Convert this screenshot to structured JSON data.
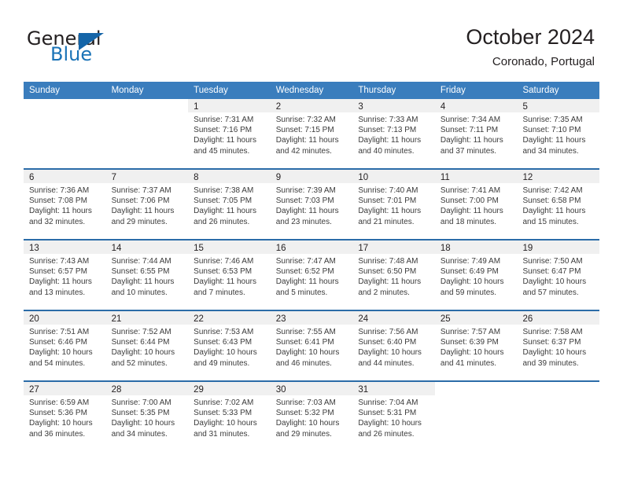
{
  "brand": {
    "name_part1": "General",
    "name_part2": "Blue",
    "accent_color": "#1a73b7",
    "triangle_color": "#1565a8"
  },
  "header": {
    "title": "October 2024",
    "subtitle": "Coronado, Portugal"
  },
  "theme": {
    "header_row_bg": "#3a7dbd",
    "week_divider": "#2b6ca8",
    "daynum_band_bg": "#f0f0f0",
    "text": "#231f20"
  },
  "weekdays": [
    "Sunday",
    "Monday",
    "Tuesday",
    "Wednesday",
    "Thursday",
    "Friday",
    "Saturday"
  ],
  "weeks": [
    [
      {
        "day": "",
        "lines": []
      },
      {
        "day": "",
        "lines": []
      },
      {
        "day": "1",
        "lines": [
          "Sunrise: 7:31 AM",
          "Sunset: 7:16 PM",
          "Daylight: 11 hours",
          "and 45 minutes."
        ]
      },
      {
        "day": "2",
        "lines": [
          "Sunrise: 7:32 AM",
          "Sunset: 7:15 PM",
          "Daylight: 11 hours",
          "and 42 minutes."
        ]
      },
      {
        "day": "3",
        "lines": [
          "Sunrise: 7:33 AM",
          "Sunset: 7:13 PM",
          "Daylight: 11 hours",
          "and 40 minutes."
        ]
      },
      {
        "day": "4",
        "lines": [
          "Sunrise: 7:34 AM",
          "Sunset: 7:11 PM",
          "Daylight: 11 hours",
          "and 37 minutes."
        ]
      },
      {
        "day": "5",
        "lines": [
          "Sunrise: 7:35 AM",
          "Sunset: 7:10 PM",
          "Daylight: 11 hours",
          "and 34 minutes."
        ]
      }
    ],
    [
      {
        "day": "6",
        "lines": [
          "Sunrise: 7:36 AM",
          "Sunset: 7:08 PM",
          "Daylight: 11 hours",
          "and 32 minutes."
        ]
      },
      {
        "day": "7",
        "lines": [
          "Sunrise: 7:37 AM",
          "Sunset: 7:06 PM",
          "Daylight: 11 hours",
          "and 29 minutes."
        ]
      },
      {
        "day": "8",
        "lines": [
          "Sunrise: 7:38 AM",
          "Sunset: 7:05 PM",
          "Daylight: 11 hours",
          "and 26 minutes."
        ]
      },
      {
        "day": "9",
        "lines": [
          "Sunrise: 7:39 AM",
          "Sunset: 7:03 PM",
          "Daylight: 11 hours",
          "and 23 minutes."
        ]
      },
      {
        "day": "10",
        "lines": [
          "Sunrise: 7:40 AM",
          "Sunset: 7:01 PM",
          "Daylight: 11 hours",
          "and 21 minutes."
        ]
      },
      {
        "day": "11",
        "lines": [
          "Sunrise: 7:41 AM",
          "Sunset: 7:00 PM",
          "Daylight: 11 hours",
          "and 18 minutes."
        ]
      },
      {
        "day": "12",
        "lines": [
          "Sunrise: 7:42 AM",
          "Sunset: 6:58 PM",
          "Daylight: 11 hours",
          "and 15 minutes."
        ]
      }
    ],
    [
      {
        "day": "13",
        "lines": [
          "Sunrise: 7:43 AM",
          "Sunset: 6:57 PM",
          "Daylight: 11 hours",
          "and 13 minutes."
        ]
      },
      {
        "day": "14",
        "lines": [
          "Sunrise: 7:44 AM",
          "Sunset: 6:55 PM",
          "Daylight: 11 hours",
          "and 10 minutes."
        ]
      },
      {
        "day": "15",
        "lines": [
          "Sunrise: 7:46 AM",
          "Sunset: 6:53 PM",
          "Daylight: 11 hours",
          "and 7 minutes."
        ]
      },
      {
        "day": "16",
        "lines": [
          "Sunrise: 7:47 AM",
          "Sunset: 6:52 PM",
          "Daylight: 11 hours",
          "and 5 minutes."
        ]
      },
      {
        "day": "17",
        "lines": [
          "Sunrise: 7:48 AM",
          "Sunset: 6:50 PM",
          "Daylight: 11 hours",
          "and 2 minutes."
        ]
      },
      {
        "day": "18",
        "lines": [
          "Sunrise: 7:49 AM",
          "Sunset: 6:49 PM",
          "Daylight: 10 hours",
          "and 59 minutes."
        ]
      },
      {
        "day": "19",
        "lines": [
          "Sunrise: 7:50 AM",
          "Sunset: 6:47 PM",
          "Daylight: 10 hours",
          "and 57 minutes."
        ]
      }
    ],
    [
      {
        "day": "20",
        "lines": [
          "Sunrise: 7:51 AM",
          "Sunset: 6:46 PM",
          "Daylight: 10 hours",
          "and 54 minutes."
        ]
      },
      {
        "day": "21",
        "lines": [
          "Sunrise: 7:52 AM",
          "Sunset: 6:44 PM",
          "Daylight: 10 hours",
          "and 52 minutes."
        ]
      },
      {
        "day": "22",
        "lines": [
          "Sunrise: 7:53 AM",
          "Sunset: 6:43 PM",
          "Daylight: 10 hours",
          "and 49 minutes."
        ]
      },
      {
        "day": "23",
        "lines": [
          "Sunrise: 7:55 AM",
          "Sunset: 6:41 PM",
          "Daylight: 10 hours",
          "and 46 minutes."
        ]
      },
      {
        "day": "24",
        "lines": [
          "Sunrise: 7:56 AM",
          "Sunset: 6:40 PM",
          "Daylight: 10 hours",
          "and 44 minutes."
        ]
      },
      {
        "day": "25",
        "lines": [
          "Sunrise: 7:57 AM",
          "Sunset: 6:39 PM",
          "Daylight: 10 hours",
          "and 41 minutes."
        ]
      },
      {
        "day": "26",
        "lines": [
          "Sunrise: 7:58 AM",
          "Sunset: 6:37 PM",
          "Daylight: 10 hours",
          "and 39 minutes."
        ]
      }
    ],
    [
      {
        "day": "27",
        "lines": [
          "Sunrise: 6:59 AM",
          "Sunset: 5:36 PM",
          "Daylight: 10 hours",
          "and 36 minutes."
        ]
      },
      {
        "day": "28",
        "lines": [
          "Sunrise: 7:00 AM",
          "Sunset: 5:35 PM",
          "Daylight: 10 hours",
          "and 34 minutes."
        ]
      },
      {
        "day": "29",
        "lines": [
          "Sunrise: 7:02 AM",
          "Sunset: 5:33 PM",
          "Daylight: 10 hours",
          "and 31 minutes."
        ]
      },
      {
        "day": "30",
        "lines": [
          "Sunrise: 7:03 AM",
          "Sunset: 5:32 PM",
          "Daylight: 10 hours",
          "and 29 minutes."
        ]
      },
      {
        "day": "31",
        "lines": [
          "Sunrise: 7:04 AM",
          "Sunset: 5:31 PM",
          "Daylight: 10 hours",
          "and 26 minutes."
        ]
      },
      {
        "day": "",
        "lines": []
      },
      {
        "day": "",
        "lines": []
      }
    ]
  ]
}
